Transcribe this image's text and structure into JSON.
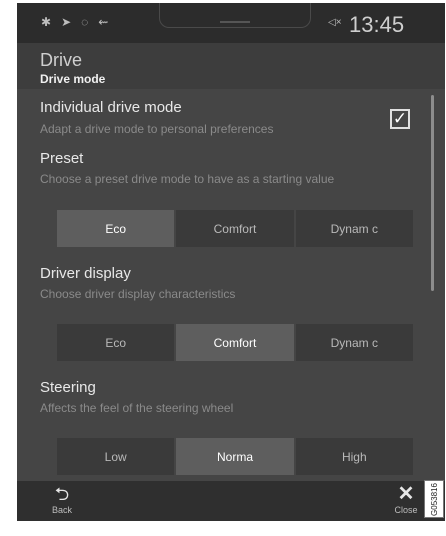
{
  "status_bar": {
    "icons": [
      "bluetooth-icon",
      "location-icon",
      "wifi-icon",
      "usb-icon"
    ],
    "icon_glyphs": [
      "✱",
      "➤",
      "◌",
      "⇜"
    ],
    "mute_glyph": "◁×",
    "time": "13:45"
  },
  "header": {
    "title": "Drive",
    "subtitle": "Drive mode"
  },
  "individual": {
    "title": "Individual drive mode",
    "description": "Adapt a drive mode to personal preferences",
    "checked": true,
    "check_glyph": "✓"
  },
  "preset": {
    "title": "Preset",
    "description": "Choose a preset drive mode to have as a starting value",
    "options": [
      "Eco",
      "Comfort",
      "Dynam c"
    ],
    "selected": "Eco"
  },
  "driver_display": {
    "title": "Driver display",
    "description": "Choose driver display characteristics",
    "options": [
      "Eco",
      "Comfort",
      "Dynam c"
    ],
    "selected": "Comfort"
  },
  "steering": {
    "title": "Steering",
    "description": "Affects the feel of the steering wheel",
    "options": [
      "Low",
      "Norma",
      "High"
    ],
    "selected": "Norma"
  },
  "bottom_bar": {
    "back_glyph": "⮌",
    "back_label": "Back",
    "close_glyph": "✕",
    "close_label": "Close"
  },
  "figure_id": "G053816",
  "colors": {
    "background": "#3d3d3d",
    "selected_segment": "#5e5e5e",
    "segment": "#3a3a3a"
  }
}
